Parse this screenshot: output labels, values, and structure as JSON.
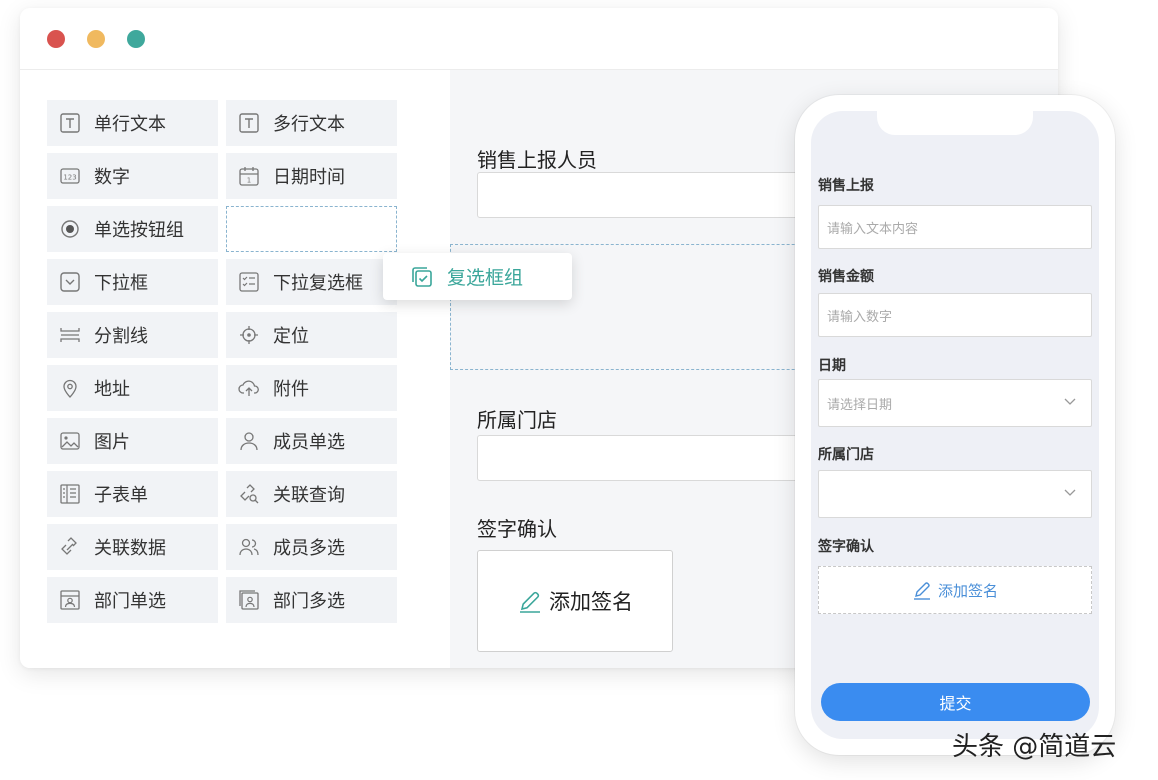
{
  "window": {
    "traffic_lights": [
      "close",
      "minimize",
      "maximize"
    ],
    "colors": {
      "red": "#d9534f",
      "yellow": "#f0b95f",
      "green": "#3fa89c"
    }
  },
  "palette": {
    "items": [
      {
        "label": "单行文本",
        "icon": "text-icon"
      },
      {
        "label": "多行文本",
        "icon": "text-icon"
      },
      {
        "label": "数字",
        "icon": "number-icon"
      },
      {
        "label": "日期时间",
        "icon": "calendar-icon"
      },
      {
        "label": "单选按钮组",
        "icon": "radio-icon"
      },
      {
        "label": "下拉框",
        "icon": "dropdown-icon"
      },
      {
        "label": "下拉复选框",
        "icon": "checklist-icon"
      },
      {
        "label": "分割线",
        "icon": "divider-icon"
      },
      {
        "label": "定位",
        "icon": "locate-icon"
      },
      {
        "label": "地址",
        "icon": "map-pin-icon"
      },
      {
        "label": "附件",
        "icon": "upload-cloud-icon"
      },
      {
        "label": "图片",
        "icon": "image-icon"
      },
      {
        "label": "成员单选",
        "icon": "user-icon"
      },
      {
        "label": "子表单",
        "icon": "subform-icon"
      },
      {
        "label": "关联查询",
        "icon": "link-search-icon"
      },
      {
        "label": "关联数据",
        "icon": "link-data-icon"
      },
      {
        "label": "成员多选",
        "icon": "users-icon"
      },
      {
        "label": "部门单选",
        "icon": "department-icon"
      },
      {
        "label": "部门多选",
        "icon": "department-multi-icon"
      }
    ]
  },
  "dragging": {
    "label": "复选框组",
    "icon": "checkbox-group-icon",
    "color": "#3aa69a"
  },
  "form": {
    "sales_person_label": "销售上报人员",
    "store_label": "所属门店",
    "signature_label": "签字确认",
    "signature_button": "添加签名"
  },
  "mobile": {
    "sales_report_label": "销售上报",
    "sales_report_placeholder": "请输入文本内容",
    "amount_label": "销售金额",
    "amount_placeholder": "请输入数字",
    "date_label": "日期",
    "date_placeholder": "请选择日期",
    "store_label": "所属门店",
    "signature_label": "签字确认",
    "signature_button": "添加签名",
    "submit_button": "提交",
    "accent": "#3a8cf0"
  },
  "watermark": "头条 @简道云"
}
